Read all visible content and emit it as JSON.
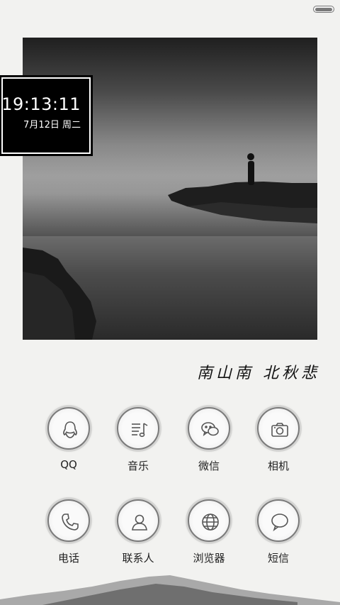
{
  "status_bar": {
    "battery_icon": "battery-icon"
  },
  "clock_widget": {
    "time": "19:13:11",
    "date": "7月12日  周二"
  },
  "poem": "南山南 北秋悲",
  "apps": [
    {
      "label": "QQ",
      "icon": "qq-icon"
    },
    {
      "label": "音乐",
      "icon": "music-icon"
    },
    {
      "label": "微信",
      "icon": "wechat-icon"
    },
    {
      "label": "相机",
      "icon": "camera-icon"
    },
    {
      "label": "电话",
      "icon": "phone-icon"
    },
    {
      "label": "联系人",
      "icon": "contact-icon"
    },
    {
      "label": "浏览器",
      "icon": "browser-icon"
    },
    {
      "label": "短信",
      "icon": "message-icon"
    }
  ]
}
